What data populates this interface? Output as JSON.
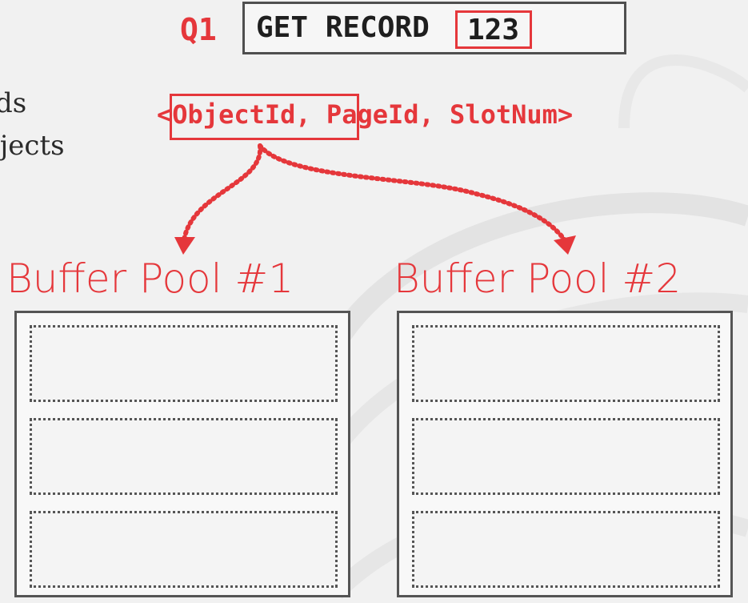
{
  "partial_text": {
    "line1": "ds",
    "line2": "bjects"
  },
  "query": {
    "label": "Q1",
    "command": "GET RECORD",
    "record_id": "123"
  },
  "record_id_format": {
    "open": "<",
    "object_id": "ObjectId,",
    "rest": " PageId, SlotNum>"
  },
  "buffer_pools": [
    {
      "title": "Buffer Pool #1"
    },
    {
      "title": "Buffer Pool #2"
    }
  ],
  "colors": {
    "accent": "#e5373b",
    "border": "#555555",
    "background": "#f1f1f1"
  }
}
